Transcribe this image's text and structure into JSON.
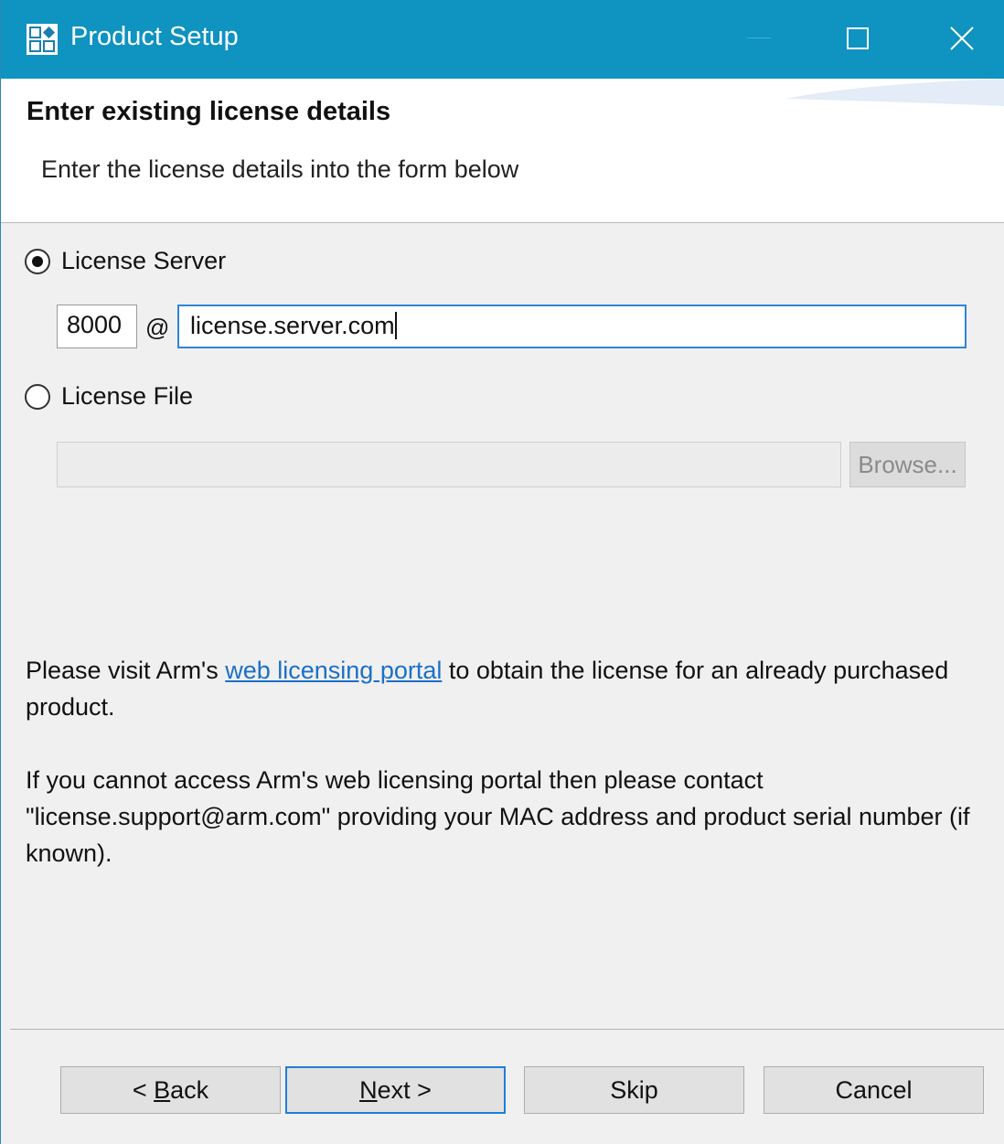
{
  "window": {
    "title": "Product Setup",
    "accent_color": "#0f93c0"
  },
  "header": {
    "title": "Enter existing license details",
    "description": "Enter the license details into the form below"
  },
  "license_server": {
    "label": "License Server",
    "selected": true,
    "port": "8000",
    "separator": "@",
    "host": "license.server.com"
  },
  "license_file": {
    "label": "License File",
    "selected": false,
    "path": "",
    "browse_label": "Browse..."
  },
  "info": {
    "portal_prefix": "Please visit Arm's ",
    "portal_link": "web licensing portal",
    "portal_suffix": " to obtain the license for an already purchased product.",
    "support_text": "If you cannot access Arm's web licensing portal then please contact \"license.support@arm.com\" providing your MAC address and product serial number (if known)."
  },
  "buttons": {
    "back_prefix": "< ",
    "back_mnemonic": "B",
    "back_rest": "ack",
    "next_mnemonic": "N",
    "next_rest": "ext >",
    "skip": "Skip",
    "cancel": "Cancel"
  },
  "icons": {
    "app": "product-setup-icon",
    "minimize": "minimize-icon",
    "maximize": "maximize-icon",
    "close": "close-icon"
  }
}
